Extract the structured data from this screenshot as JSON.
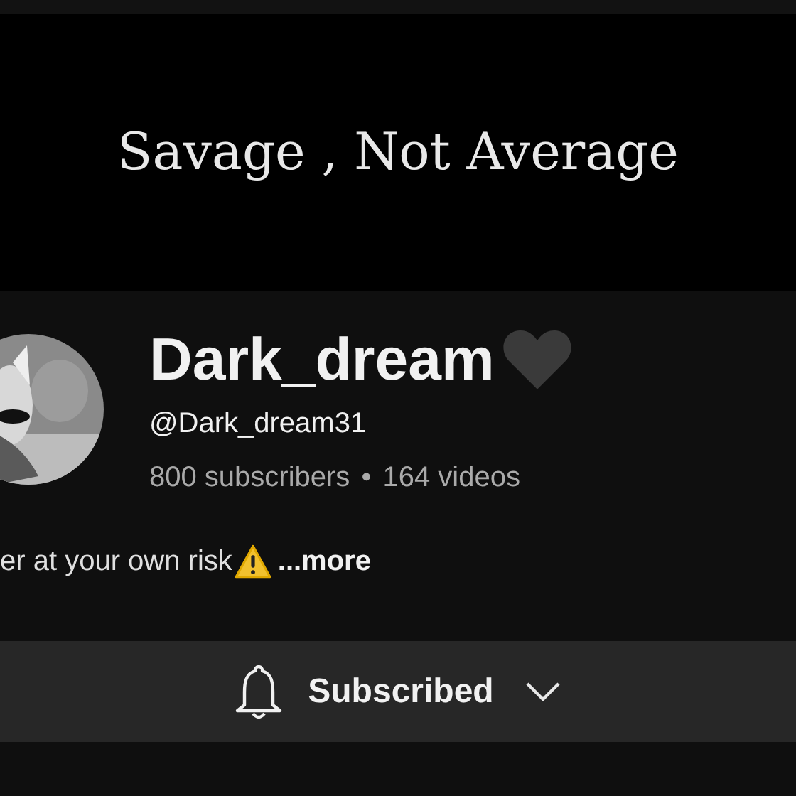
{
  "banner": {
    "text": "Savage , Not Average"
  },
  "channel": {
    "name": "Dark_dream",
    "handle": "@Dark_dream31",
    "subscribers": "800 subscribers",
    "separator": "•",
    "videos": "164 videos"
  },
  "description": {
    "text": "er at your own risk",
    "more": "...more"
  },
  "subscribe_button": {
    "label": "Subscribed"
  }
}
